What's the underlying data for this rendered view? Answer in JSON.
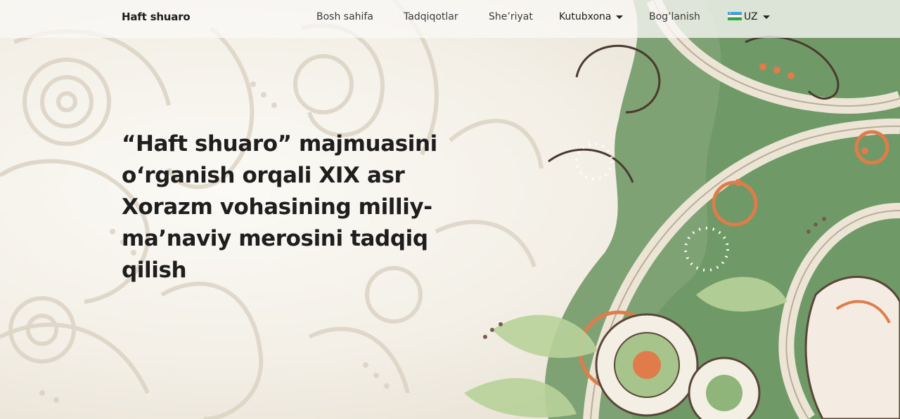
{
  "nav": {
    "brand": "Haft shuaro",
    "items": [
      {
        "label": "Bosh sahifa"
      },
      {
        "label": "Tadqiqotlar"
      },
      {
        "label": "She’riyat"
      },
      {
        "label": "Kutubxona"
      },
      {
        "label": "Bog’lanish"
      }
    ],
    "language": {
      "label": "UZ",
      "flag_icon": "uzbekistan-flag-icon"
    }
  },
  "hero": {
    "title": "“Haft shuaro” majmuasini o‘rganish orqali XIX asr Xorazm vohasining milliy-ma’naviy merosini tadqiq qilish"
  },
  "colors": {
    "background": "#f2efe8",
    "ornament_green": "#6f9a68",
    "ornament_orange": "#e07b4a",
    "ornament_beige": "#cfc4b2",
    "text": "#1e1e1e"
  }
}
